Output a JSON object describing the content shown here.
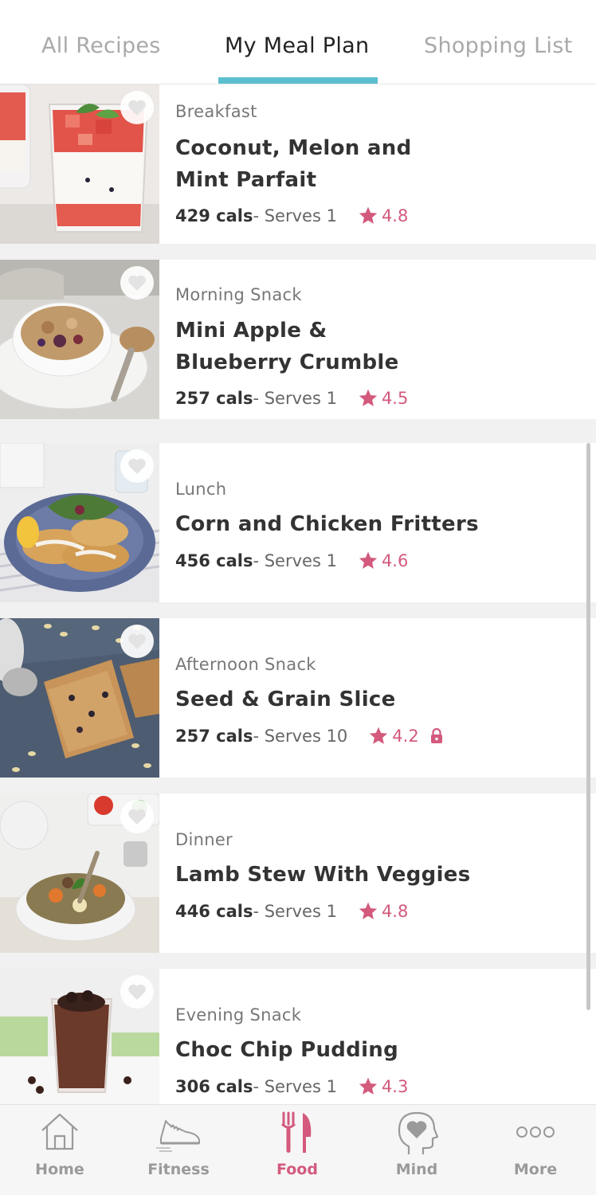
{
  "tabs": [
    {
      "label": "All Recipes"
    },
    {
      "label": "My Meal Plan"
    },
    {
      "label": "Shopping List"
    }
  ],
  "active_tab": "My Meal Plan",
  "colors": {
    "accent_tab": "#5cbfcf",
    "rating": "#d35a7d",
    "active_nav": "#d35a7d"
  },
  "recipes": [
    {
      "meal": "Breakfast",
      "title_lines": [
        "Coconut, Melon and",
        "Mint Parfait"
      ],
      "cals": "429 cals",
      "serves": " - Serves 1",
      "rating": "4.8",
      "locked": false,
      "favorite_icon": "heart-icon"
    },
    {
      "meal": "Morning Snack",
      "title_lines": [
        "Mini Apple &",
        "Blueberry Crumble"
      ],
      "cals": "257 cals",
      "serves": " - Serves 1",
      "rating": "4.5",
      "locked": false,
      "favorite_icon": "heart-icon"
    },
    {
      "meal": "Lunch",
      "title_lines": [
        "Corn and Chicken Fritters"
      ],
      "cals": "456 cals",
      "serves": " - Serves 1",
      "rating": "4.6",
      "locked": false,
      "favorite_icon": "heart-icon"
    },
    {
      "meal": "Afternoon Snack",
      "title_lines": [
        "Seed & Grain Slice"
      ],
      "cals": "257 cals",
      "serves": " - Serves 10",
      "rating": "4.2",
      "locked": true,
      "favorite_icon": "heart-icon"
    },
    {
      "meal": "Dinner",
      "title_lines": [
        "Lamb Stew With Veggies"
      ],
      "cals": "446 cals",
      "serves": " - Serves 1",
      "rating": "4.8",
      "locked": false,
      "favorite_icon": "heart-icon"
    },
    {
      "meal": "Evening Snack",
      "title_lines": [
        "Choc Chip Pudding"
      ],
      "cals": "306 cals",
      "serves": " - Serves 1",
      "rating": "4.3",
      "locked": false,
      "favorite_icon": "heart-icon"
    }
  ],
  "nav": [
    {
      "label": "Home",
      "icon": "home-icon",
      "active": false
    },
    {
      "label": "Fitness",
      "icon": "sneaker-icon",
      "active": false
    },
    {
      "label": "Food",
      "icon": "fork-knife-icon",
      "active": true
    },
    {
      "label": "Mind",
      "icon": "head-heart-icon",
      "active": false
    },
    {
      "label": "More",
      "icon": "more-dots-icon",
      "active": false
    }
  ]
}
